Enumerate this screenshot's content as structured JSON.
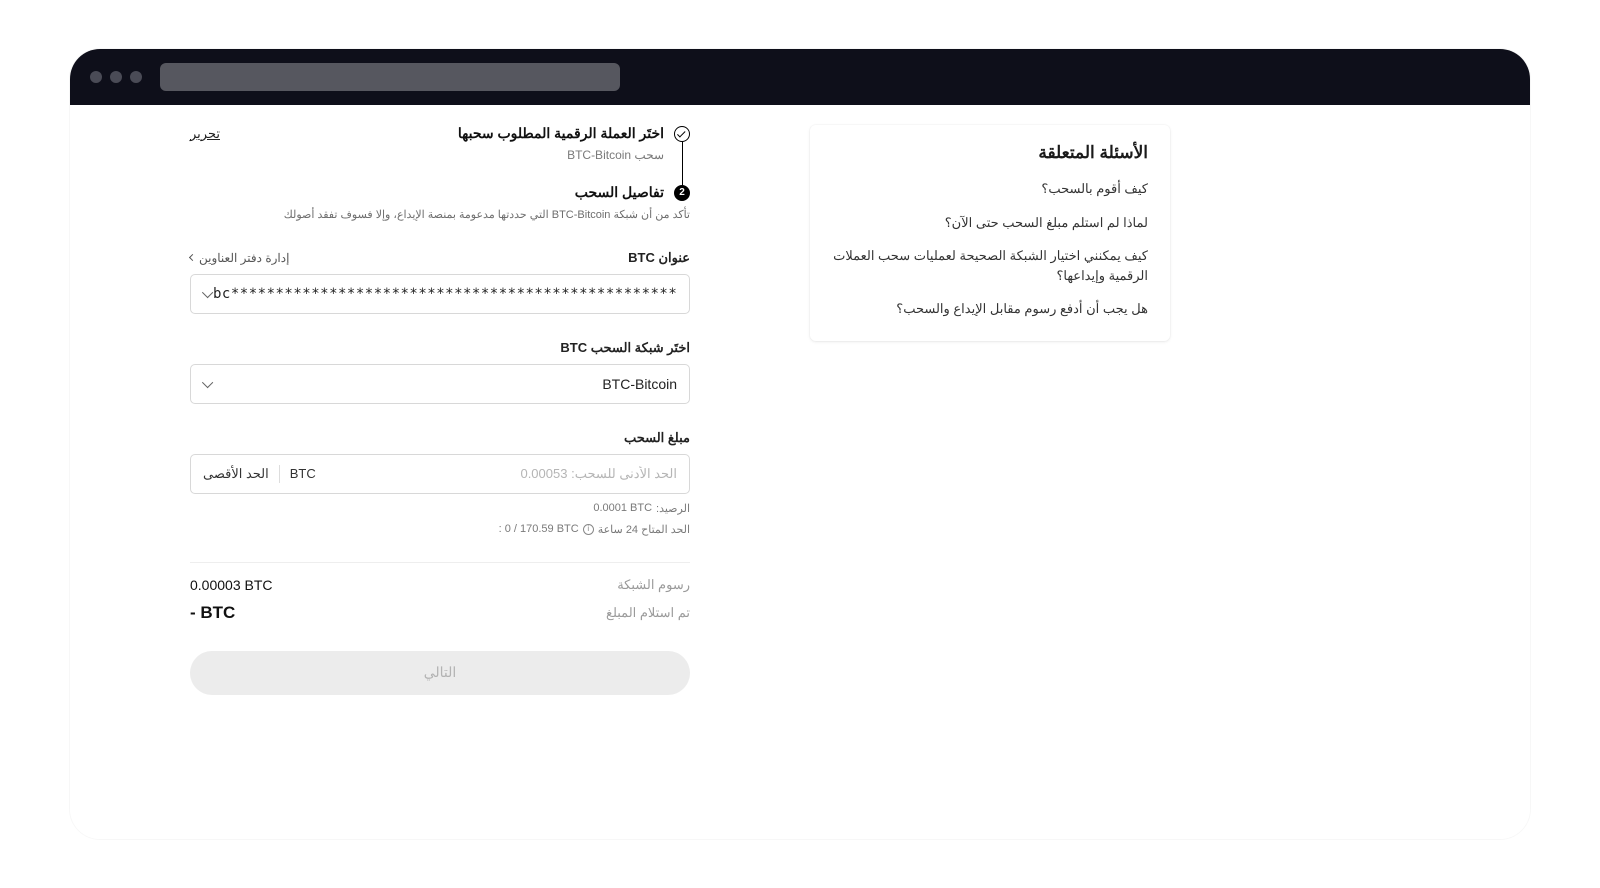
{
  "step1": {
    "title": "اختَر العملة الرقمية المطلوب سحبها",
    "edit": "تحرير",
    "sub": "سحب BTC-Bitcoin"
  },
  "step2": {
    "number": "2",
    "title": "تفاصيل السحب",
    "note": "تأكد من أن شبكة BTC-Bitcoin التي حددتها مدعومة بمنصة الإيداع، وإلا فسوف تفقد أصولك"
  },
  "address": {
    "label": "عنوان BTC",
    "manage": "إدارة دفتر العناوين",
    "value": "bc*******************************************************"
  },
  "network": {
    "label": "اختَر شبكة السحب BTC",
    "value": "BTC-Bitcoin"
  },
  "amount": {
    "label": "مبلغ السحب",
    "placeholder": "الحد الأدنى للسحب: 0.00053",
    "unit": "BTC",
    "max": "الحد الأقصى",
    "balance_label": "الرصيد:",
    "balance_value": "0.0001 BTC",
    "limit_label": "الحد المتاح 24 ساعة",
    "limit_value": ": 0 / 170.59 BTC"
  },
  "summary": {
    "fee_label": "رسوم الشبكة",
    "fee_value": "0.00003 BTC",
    "recv_label": "تم استلام المبلغ",
    "recv_value": "- BTC"
  },
  "next": "التالي",
  "faq": {
    "title": "الأسئلة المتعلقة",
    "items": [
      "كيف أقوم بالسحب؟",
      "لماذا لم استلم مبلغ السحب حتى الآن؟",
      "كيف يمكنني اختيار الشبكة الصحيحة لعمليات سحب العملات الرقمية وإيداعها؟",
      "هل يجب أن أدفع رسوم مقابل الإيداع والسحب؟"
    ]
  }
}
